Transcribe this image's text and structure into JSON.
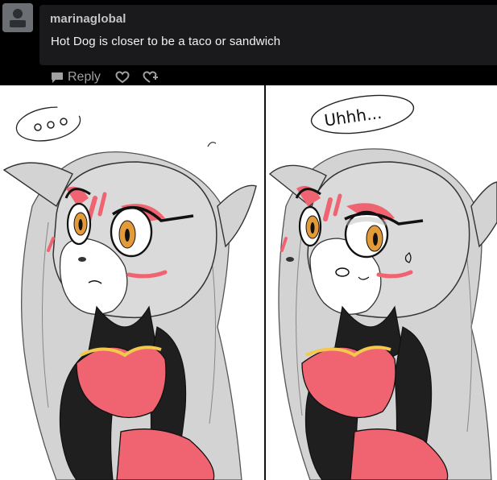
{
  "comment": {
    "username": "marinaglobal",
    "text": "Hot Dog is closer to be a taco or sandwich",
    "avatar_icon": "default-avatar-icon"
  },
  "actions": {
    "reply_label": "Reply",
    "reply_icon": "speech-bubble-icon",
    "like_icon": "heart-icon",
    "reblog_icon": "heart-reblog-icon"
  },
  "comic": {
    "right_panel_text": "Uhhh..."
  },
  "colors": {
    "comment_bg": "#000000",
    "bubble_bg": "#1a1a1c",
    "username": "#c4c4c4",
    "comment_text": "#f2f2f2",
    "action_gray": "#a0a0a0",
    "hair": "#d3d3d3",
    "eyeshadow": "#f06472",
    "iris": "#e39b3a",
    "dress": "#f06472",
    "bodysuit": "#1f1f1f"
  }
}
